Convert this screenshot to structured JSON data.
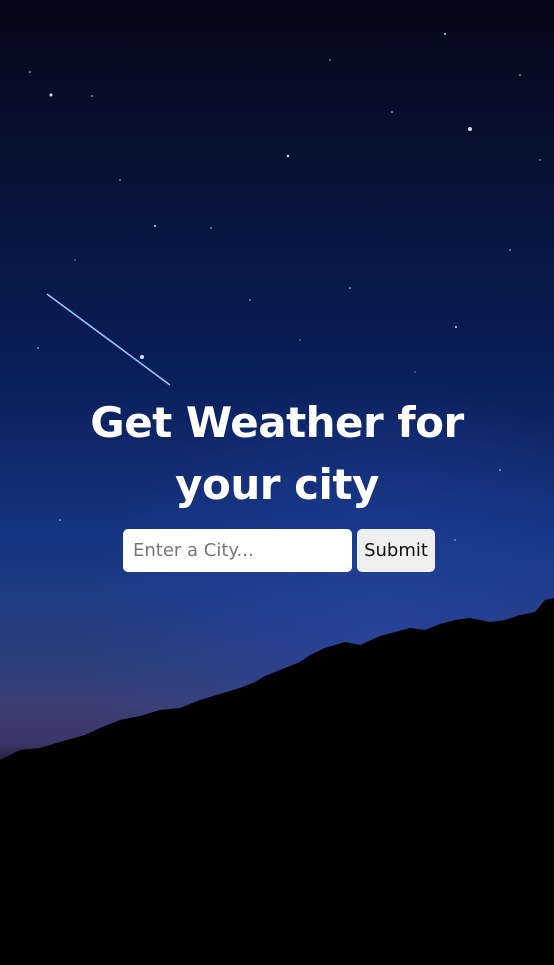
{
  "page": {
    "title_line1": "Get Weather for",
    "title_line2": "your city"
  },
  "search": {
    "placeholder": "Enter a City...",
    "value": "",
    "submit_label": "Submit"
  },
  "colors": {
    "sky_top": "#040817",
    "sky_mid": "#0b1f5c",
    "title_text": "#ffffff",
    "button_bg": "#efefef"
  },
  "icons": {
    "background": "night-sky-shooting-star"
  }
}
